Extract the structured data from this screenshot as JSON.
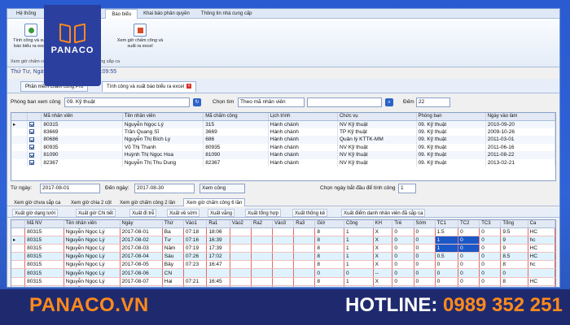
{
  "ribbon": {
    "tabs": [
      "Hệ thống",
      "",
      "Cài đặt chấm công",
      "Báo biểu",
      "Khai báo phân quyền",
      "Thông tin nhà cung cấp"
    ],
    "active_tab": 3,
    "btn1_label": "Tính công và xuất báo biểu ra excel",
    "btn2_label": "Xem giờ chấm công và xuất ra excel",
    "group_label": "Xem giờ chấm công    Xem giờ chấm công không sắp ca"
  },
  "date_line": "Thứ Tư, Ngày: 04-10-2017, Giờ: 21:09:55",
  "doc_tabs": [
    "Phần mềm chấm công Pro",
    "Tính công và xuất báo biểu ra excel"
  ],
  "filter": {
    "dept_label": "Phòng ban xem công",
    "dept_value": "09. Kỹ thuật",
    "search_label": "Chọn tìm",
    "search_value": "Theo mã nhân viên",
    "count_label": "Đếm",
    "count_value": "22"
  },
  "employees": {
    "headers": [
      "",
      "Mã nhân viên",
      "Tên nhân viên",
      "Mã chấm công",
      "Lịch trình",
      "Chức vụ",
      "Phòng ban",
      "Ngày vào làm"
    ],
    "rows": [
      [
        "80315",
        "Nguyễn Ngọc Lý",
        "315",
        "Hành chánh",
        "NV Kỹ thuật",
        "09. Kỹ thuật",
        "2010-09-20"
      ],
      [
        "83669",
        "Trần Quang Sĩ",
        "3669",
        "Hành chánh",
        "TP Kỹ thuật",
        "09. Kỹ thuật",
        "2009-10-26"
      ],
      [
        "80686",
        "Nguyễn Thị Bích Ly",
        "686",
        "Hành chánh",
        "Quản lý KTTK-MM",
        "09. Kỹ thuật",
        "2011-03-01"
      ],
      [
        "80935",
        "Võ Thị Thanh",
        "80935",
        "Hành chánh",
        "NV Kỹ thuật",
        "09. Kỹ thuật",
        "2011-06-16"
      ],
      [
        "81090",
        "Huỳnh Thị Ngọc Hoa",
        "81090",
        "Hành chánh",
        "NV Kỹ thuật",
        "09. Kỹ thuật",
        "2011-08-22"
      ],
      [
        "82367",
        "Nguyễn Thị Thu Dung",
        "82367",
        "Hành chánh",
        "NV Kỹ thuật",
        "09. Kỹ thuật",
        "2013-02-21"
      ]
    ]
  },
  "date_range": {
    "from_label": "Từ ngày:",
    "from_value": "2017-08-01",
    "to_label": "Đến ngày:",
    "to_value": "2017-08-30",
    "view_btn": "Xem công",
    "start_day_label": "Chọn ngày bắt đầu để tính công",
    "start_day_value": "1"
  },
  "sub_tabs": [
    "Xem giờ chưa sắp ca",
    "Xem giờ chia 2 cột",
    "Xem giờ chấm công 2 lần",
    "Xem giờ chấm công 6 lần"
  ],
  "tools": [
    "Xuất giờ dạng lưới",
    "Xuất giờ Chi tiết",
    "Xuất đi trễ",
    "Xuất về sớm",
    "Xuất vắng",
    "Xuất tổng hợp",
    "Xuất thống kê",
    "Xuất điểm danh nhân viên đã sắp ca"
  ],
  "attendance": {
    "headers": [
      "Mã NV",
      "Tên nhân viên",
      "Ngày",
      "Thứ",
      "Vào1",
      "Ra1",
      "Vào2",
      "Ra2",
      "Vào3",
      "Ra3",
      "Giờ",
      "Công",
      "KH",
      "Trễ",
      "Sớm",
      "TC1",
      "TC2",
      "TC3",
      "Tổng",
      "Ca"
    ],
    "rows": [
      [
        "80315",
        "Nguyễn Ngọc Lý",
        "2017-08-01",
        "Ba",
        "07:18",
        "18:06",
        "",
        "",
        "",
        "",
        "8",
        "1",
        "X",
        "0",
        "0",
        "1.5",
        "0",
        "0",
        "9.5",
        "HC"
      ],
      [
        "80315",
        "Nguyễn Ngọc Lý",
        "2017-08-02",
        "Tư",
        "07:16",
        "16:39",
        "",
        "",
        "",
        "",
        "8",
        "1",
        "X",
        "0",
        "0",
        "1",
        "0",
        "0",
        "9",
        "hc"
      ],
      [
        "80315",
        "Nguyễn Ngọc Lý",
        "2017-08-03",
        "Năm",
        "07:19",
        "17:39",
        "",
        "",
        "",
        "",
        "8",
        "1",
        "X",
        "0",
        "0",
        "1",
        "0",
        "0",
        "9",
        "HC"
      ],
      [
        "80315",
        "Nguyễn Ngọc Lý",
        "2017-08-04",
        "Sáu",
        "07:26",
        "17:02",
        "",
        "",
        "",
        "",
        "8",
        "1",
        "X",
        "0",
        "0",
        "0.5",
        "0",
        "0",
        "8.5",
        "HC"
      ],
      [
        "80315",
        "Nguyễn Ngọc Lý",
        "2017-08-05",
        "Bảy",
        "07:23",
        "16:47",
        "",
        "",
        "",
        "",
        "8",
        "1",
        "X",
        "0",
        "0",
        "0",
        "0",
        "0",
        "8",
        "hc"
      ],
      [
        "80315",
        "Nguyễn Ngọc Lý",
        "2017-08-06",
        "CN",
        "",
        "",
        "",
        "",
        "",
        "",
        "0",
        "0",
        "--",
        "0",
        "0",
        "0",
        "0",
        "0",
        "0",
        ""
      ],
      [
        "80315",
        "Nguyễn Ngọc Lý",
        "2017-08-07",
        "Hai",
        "07:21",
        "16:45",
        "",
        "",
        "",
        "",
        "8",
        "1",
        "X",
        "0",
        "0",
        "0",
        "0",
        "0",
        "8",
        "HC"
      ],
      [
        "80315",
        "Nguyễn Ngọc Lý",
        "2017-08-08",
        "Ba",
        "07:23",
        "17:17",
        "",
        "",
        "",
        "",
        "8",
        "1",
        "X",
        "0",
        "0",
        "0",
        "0",
        "0",
        "8",
        ""
      ]
    ]
  },
  "footer": {
    "brand": "PANACO.VN",
    "hotline_label": "HOTLINE:",
    "hotline_number": "0989 352 251",
    "logo_text": "PANACO"
  },
  "colors": {
    "accent": "#ff8a1c",
    "brand_bg": "#2b3f9e",
    "selected_cell": "#1a58c8"
  }
}
